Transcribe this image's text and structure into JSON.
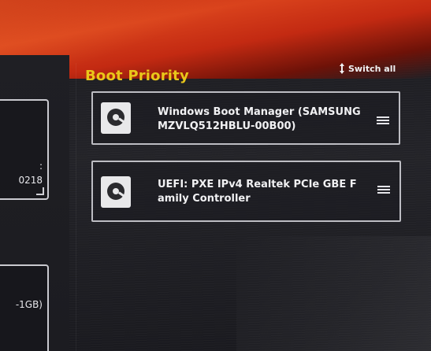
{
  "colors": {
    "accent_title": "#e9c71a",
    "banner_red": "#c32a12",
    "text": "#f1f1f3",
    "border": "#bdbdc3"
  },
  "left_panel": {
    "card1": {
      "fragment_top": ":",
      "fragment_bottom": "0218",
      "icon": "resize-corner-icon"
    },
    "card2": {
      "fragment": "-1GB)"
    }
  },
  "boot_priority": {
    "title": "Boot Priority",
    "switch_all_label": "Switch all",
    "switch_icon": "swap-vertical-icon",
    "items": [
      {
        "label": "Windows Boot Manager (SAMSUNG MZVLQ512HBLU-00B00)",
        "icon": "hard-disk-icon",
        "handle_icon": "drag-handle-icon"
      },
      {
        "label": "UEFI: PXE IPv4 Realtek PCIe GBE Family Controller",
        "icon": "hard-disk-icon",
        "handle_icon": "drag-handle-icon"
      }
    ]
  }
}
